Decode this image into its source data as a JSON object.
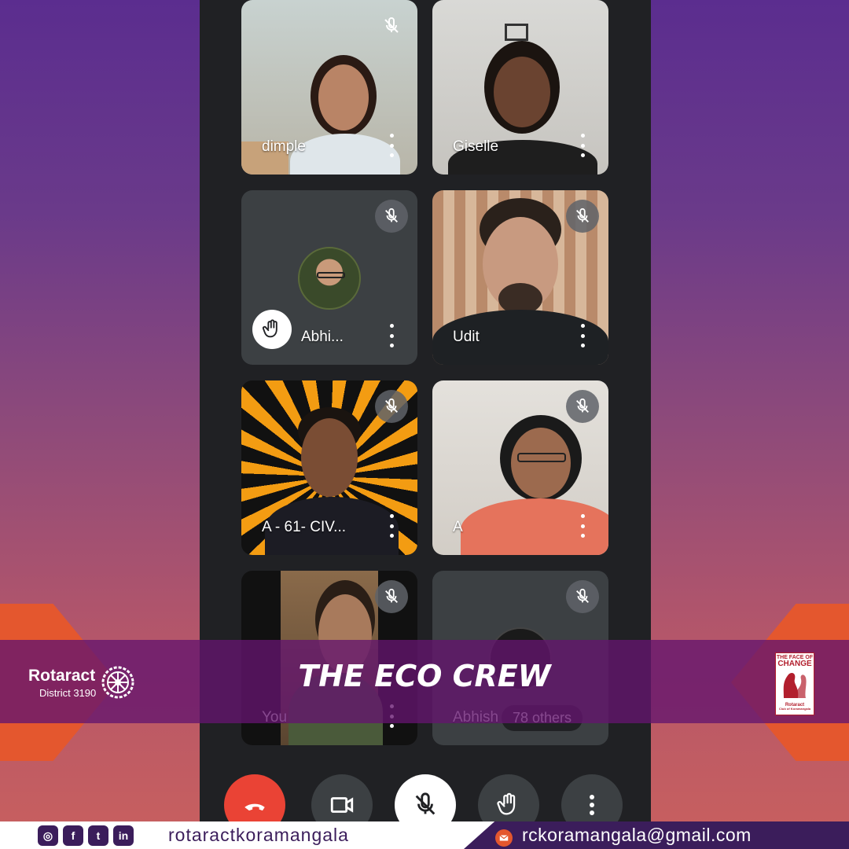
{
  "participants": [
    {
      "name": "dimple"
    },
    {
      "name": "Giselle"
    },
    {
      "name": "Abhi..."
    },
    {
      "name": "Udit"
    },
    {
      "name": "A - 61- CIV..."
    },
    {
      "name": "A"
    },
    {
      "name": "You"
    },
    {
      "name": "Abhish",
      "others": "78 others"
    }
  ],
  "banner": {
    "title": "THE ECO CREW",
    "brand": "Rotaract",
    "district": "District 3190",
    "right_logo_line1": "THE FACE OF",
    "right_logo_line2": "CHANGE",
    "right_logo_line3": "Rotaract",
    "right_logo_line4": "Club of Koramangala"
  },
  "controls": [
    "end-call",
    "camera",
    "microphone-muted",
    "raise-hand",
    "more-options"
  ],
  "footer": {
    "social_instagram": "◎",
    "social_facebook": "f",
    "social_twitter": "t",
    "social_linkedin": "in",
    "handle": "rotaractkoramangala",
    "email": "rckoramangala@gmail.com"
  },
  "colors": {
    "end_call": "#ea4335",
    "control_bg": "#3c4043",
    "banner": "#64146e",
    "accent_orange": "#e4572e",
    "footer_purple": "#3b1d5b"
  }
}
